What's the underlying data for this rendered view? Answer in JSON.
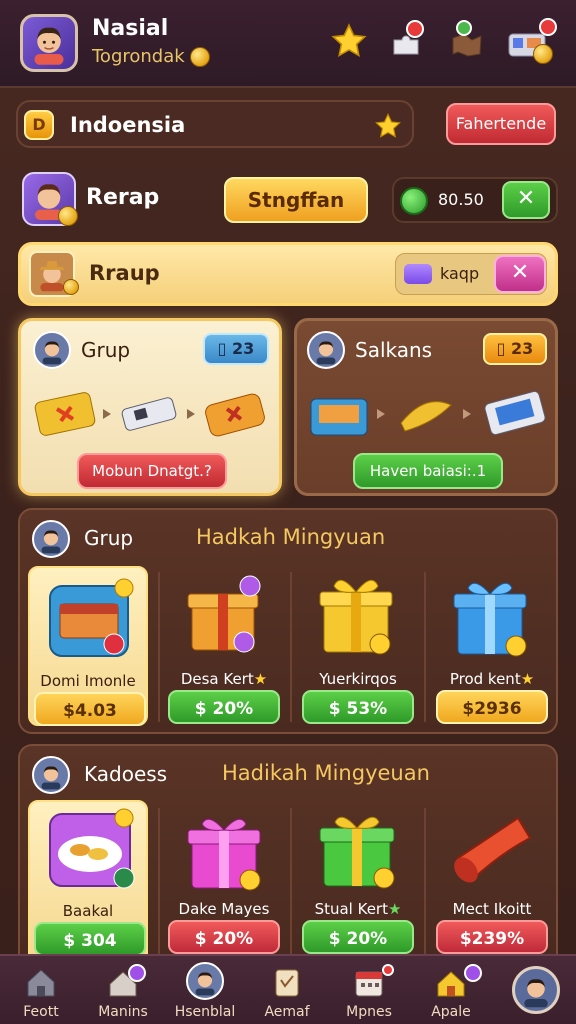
{
  "header": {
    "name": "Nasial",
    "subtitle": "Togrondak"
  },
  "region_bar": {
    "title": "Indoensia",
    "button": "Fahertende"
  },
  "row1": {
    "label": "Rerap",
    "action": "Stngffan",
    "value": "80.50"
  },
  "row2": {
    "label": "Rraup",
    "value": "kaqp"
  },
  "card_left": {
    "title": "Grup",
    "badge": "23",
    "button": "Mobun Dnatgt.?"
  },
  "card_right": {
    "title": "Salkans",
    "badge": "23",
    "button": "Haven baiasi:.1"
  },
  "section1": {
    "title": "Grup",
    "heading": "Hadkah Mingyuan",
    "items": [
      {
        "name": "Domi Imonle",
        "price": "$4.03",
        "style": "yellow"
      },
      {
        "name": "Desa Kert",
        "price": "$ 20%",
        "style": "green"
      },
      {
        "name": "Yuerkirqos",
        "price": "$ 53%",
        "style": "green"
      },
      {
        "name": "Prod kent",
        "price": "$2936",
        "style": "yellow"
      }
    ]
  },
  "section2": {
    "title": "Kadoess",
    "heading": "Hadikah Mingyeuan",
    "items": [
      {
        "name": "Baakal",
        "price": "$ 304",
        "style": "green"
      },
      {
        "name": "Dake Mayes",
        "price": "$ 20%",
        "style": "red"
      },
      {
        "name": "Stual Kert",
        "price": "$ 20%",
        "style": "green"
      },
      {
        "name": "Mect Ikoitt",
        "price": "$239%",
        "style": "red"
      }
    ]
  },
  "nav": [
    {
      "label": "Feott",
      "icon": "home-icon"
    },
    {
      "label": "Manins",
      "icon": "house-badge-icon"
    },
    {
      "label": "Hsenblal",
      "icon": "profile-icon"
    },
    {
      "label": "Aemaf",
      "icon": "scroll-icon"
    },
    {
      "label": "Mpnes",
      "icon": "calendar-icon"
    },
    {
      "label": "Apale",
      "icon": "house-yellow-icon"
    },
    {
      "label": "",
      "icon": "avatar-icon"
    }
  ],
  "colors": {
    "background": "#3d231d",
    "accent_yellow": "#f5c860",
    "green": "#2f9a2a",
    "red": "#c02a3a"
  }
}
